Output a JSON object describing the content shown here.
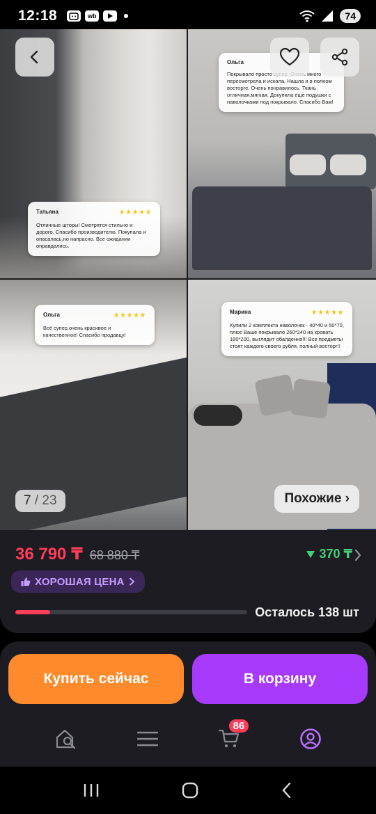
{
  "status_bar": {
    "time": "12:18",
    "app_icons": [
      "messenger-icon",
      "wb-icon",
      "youtube-icon"
    ],
    "wb_label": "wb",
    "battery": "74"
  },
  "gallery": {
    "reviews": [
      {
        "name": "Татьяна",
        "stars": "★★★★★",
        "text": "Отличные шторы! Смотрятся стильно и дорого. Спасибо производителю. Покупала и опасалась,но напрасно. Все ожидании оправдались."
      },
      {
        "name": "Ольга",
        "stars": "",
        "text": "Покрывало просто супер. Очень много пересмотрела и искала. Нашла и в полном восторге. Очень понравилось. Ткань отличная,мягкая. Докупила еще подушки с наволочками под покрывало. Спасибо Вам!"
      },
      {
        "name": "Ольга",
        "stars": "★★★★★",
        "text": "Всё супер,очень красивое и качественное! Спасибо продавцу!"
      },
      {
        "name": "Марина",
        "stars": "★★★★★",
        "text": "Купили 2 комплекта наволочек - 40*40 и 50*70, плюс Ваше покрывало 260*240 на кровать 180*200, выглядит обалденно!!! Все предметы стоят каждого своего рубля, полный восторг!!"
      }
    ],
    "counter_current": "7",
    "counter_total": "/ 23",
    "similar_label": "Похожие ›"
  },
  "price": {
    "current": "36 790 ₸",
    "old": "68 880 ₸",
    "cashback": "370 ₸",
    "good_price_label": "ХОРОШАЯ ЦЕНА",
    "stock_text": "Осталось 138 шт",
    "stock_level": 0.15
  },
  "actions": {
    "buy_now": "Купить сейчас",
    "add_to_cart": "В корзину"
  },
  "tabbar": {
    "cart_count": "86",
    "items": [
      "home-search-icon",
      "catalog-icon",
      "cart-icon",
      "profile-icon"
    ]
  },
  "colors": {
    "price_red": "#ff3d5a",
    "buy_orange": "#ff8a2b",
    "cart_purple": "#a73afd",
    "cashback_green": "#42d07a",
    "badge_bg": "#3a2758",
    "badge_text": "#c79cff"
  }
}
